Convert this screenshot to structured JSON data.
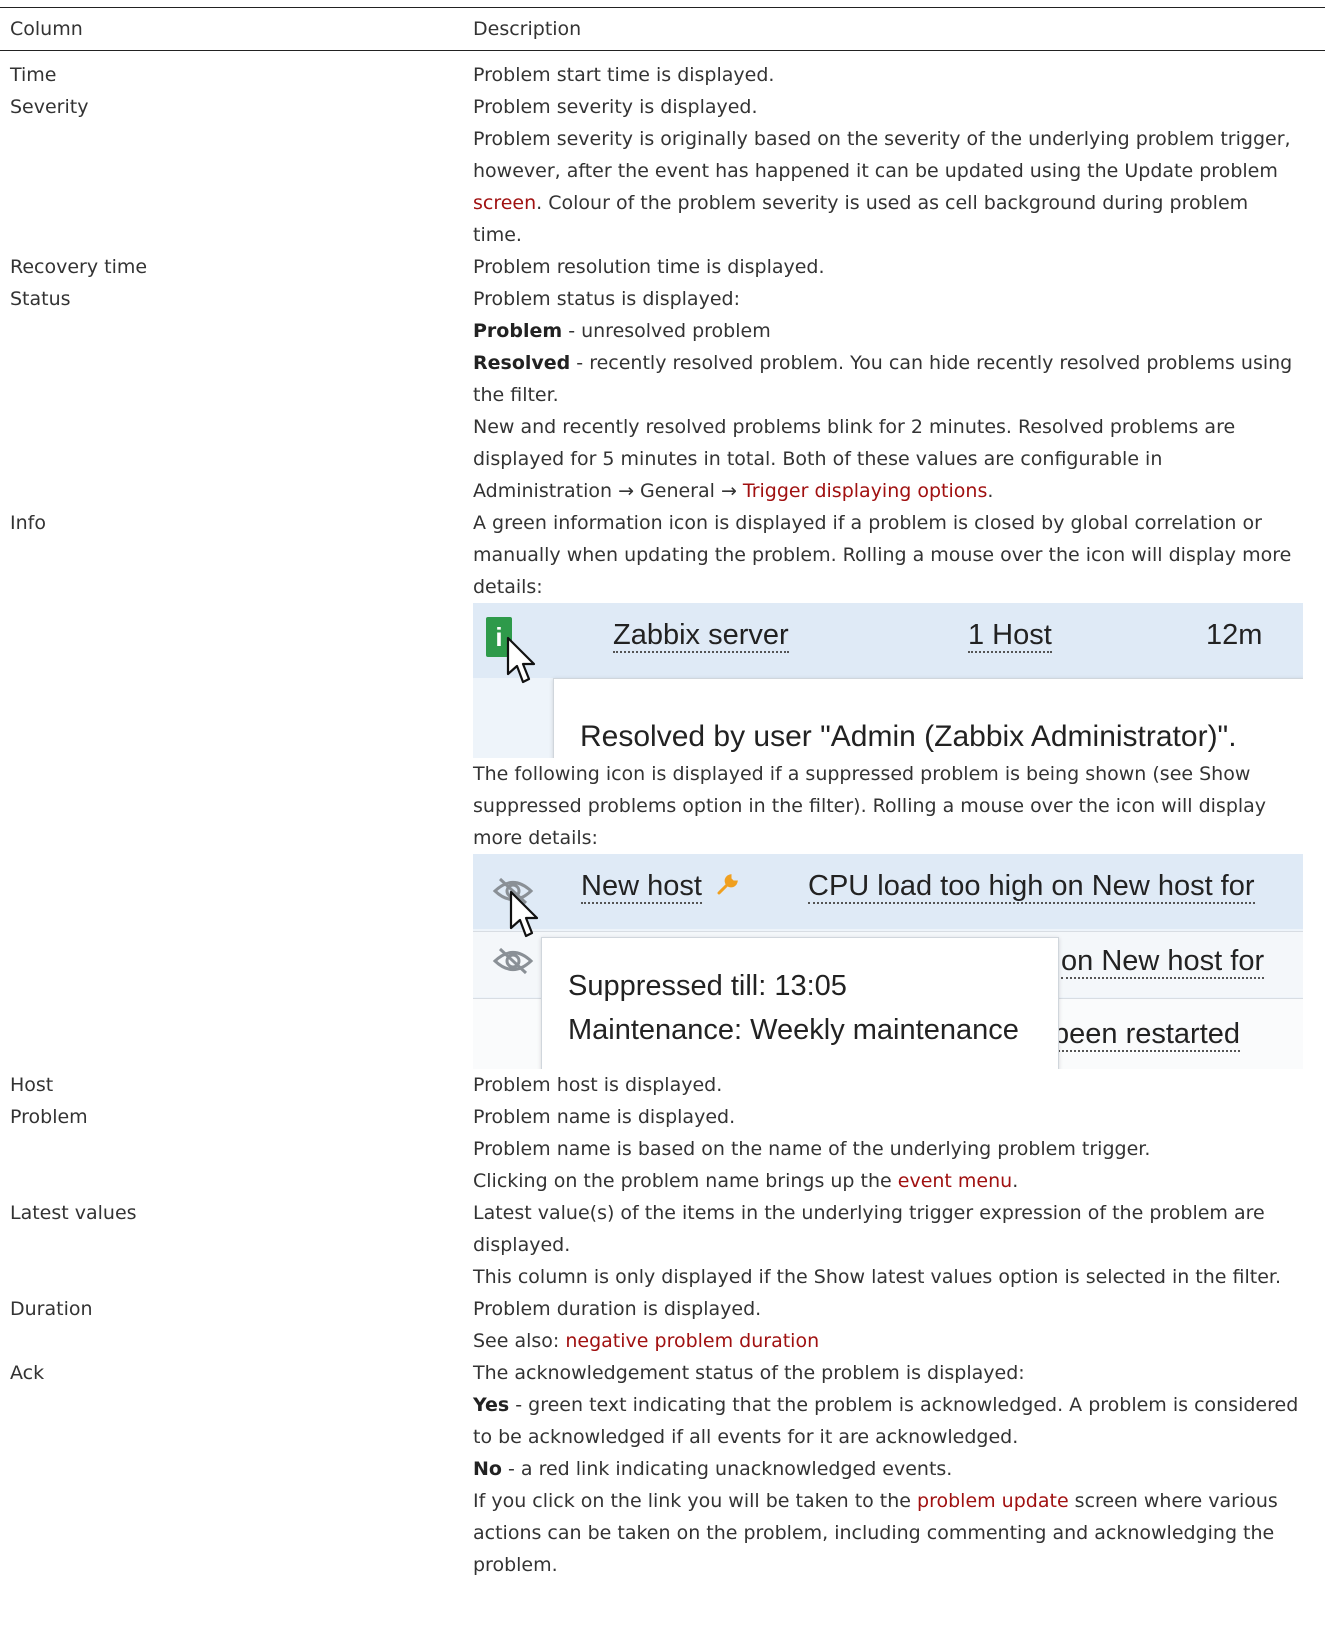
{
  "header": {
    "column": "Column",
    "description": "Description"
  },
  "rows": {
    "time": {
      "name": "Time",
      "d1": "Problem start time is displayed."
    },
    "severity": {
      "name": "Severity",
      "d1": "Problem severity is displayed.",
      "d2": "Problem severity is originally based on the severity of the underlying problem trigger, however, after the event has happened it can be updated using the Update problem ",
      "d2_link": "screen",
      "d2_end": ". Colour of the problem severity is used as cell background during problem time."
    },
    "recovery": {
      "name": "Recovery time",
      "d1": "Problem resolution time is displayed."
    },
    "status": {
      "name": "Status",
      "d1": "Problem status is displayed:",
      "problem_label": "Problem",
      "problem_text": " - unresolved problem",
      "resolved_label": "Resolved",
      "resolved_text": " - recently resolved problem. You can hide recently resolved problems using the filter.",
      "d4": "New and recently resolved problems blink for 2 minutes. Resolved problems are displayed for 5 minutes in total. Both of these values are configurable in Administration → General → ",
      "d4_link": "Trigger displaying options",
      "d4_end": "."
    },
    "info": {
      "name": "Info",
      "d1": "A green information icon is displayed if a problem is closed by global correlation or manually when updating the problem. Rolling a mouse over the icon will display more details:",
      "d2": "The following icon is displayed if a suppressed problem is being shown (see Show suppressed problems option in the filter). Rolling a mouse over the icon will display more details:"
    },
    "host": {
      "name": "Host",
      "d1": "Problem host is displayed."
    },
    "problem": {
      "name": "Problem",
      "d1": "Problem name is displayed.",
      "d2": "Problem name is based on the name of the underlying problem trigger.",
      "d3": "Clicking on the problem name brings up the ",
      "d3_link": "event menu",
      "d3_end": "."
    },
    "latest": {
      "name": "Latest values",
      "d1": "Latest value(s) of the items in the underlying trigger expression of the problem are displayed.",
      "d2": "This column is only displayed if the Show latest values option is selected in the filter."
    },
    "duration": {
      "name": "Duration",
      "d1": "Problem duration is displayed.",
      "d2": "See also: ",
      "d2_link": "negative problem duration"
    },
    "ack": {
      "name": "Ack",
      "d1": "The acknowledgement status of the problem is displayed:",
      "yes_label": "Yes",
      "yes_text": " - green text indicating that the problem is acknowledged. A problem is considered to be acknowledged if all events for it are acknowledged.",
      "no_label": "No",
      "no_text": " - a red link indicating unacknowledged events.",
      "d4": "If you click on the link you will be taken to the ",
      "d4_link": "problem update",
      "d4_end": " screen where various actions can be taken on the problem, including commenting and acknowledging the problem."
    }
  },
  "shot1": {
    "info_icon": "i",
    "host": "Zabbix server",
    "hosts": "1 Host",
    "duration": "12m",
    "tooltip": "Resolved by user \"Admin (Zabbix Administrator)\"."
  },
  "shot2": {
    "host": "New host",
    "problem": "CPU load too high on New host for",
    "problem2": "on New host for",
    "problem3": "been restarted",
    "tooltip_line1": "Suppressed till: 13:05",
    "tooltip_line2": "Maintenance: Weekly maintenance"
  },
  "colors": {
    "link": "#a01010",
    "info_icon": "#2e9a4a",
    "wrench": "#f0a020"
  }
}
